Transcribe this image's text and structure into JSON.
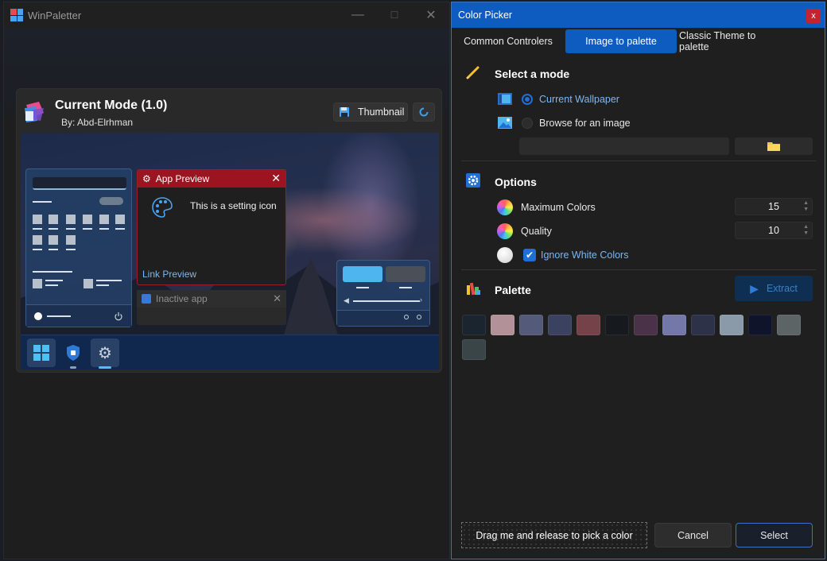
{
  "main_window": {
    "title": "WinPaletter",
    "controls": {
      "minimize": "—",
      "maximize": "☐",
      "close": "✕"
    },
    "theme_card": {
      "title": "Current Mode (1.0)",
      "author": "By: Abd-Elrhman",
      "thumbnail_label": "Thumbnail"
    },
    "preview": {
      "app_preview_title": "App Preview",
      "app_preview_text": "This is a setting icon",
      "link_preview": "Link Preview",
      "inactive_app_title": "Inactive app"
    }
  },
  "color_picker": {
    "title": "Color Picker",
    "close_label": "x",
    "tabs": [
      {
        "label": "Common Controlers",
        "active": false
      },
      {
        "label": "Image to palette",
        "active": true
      },
      {
        "label": "Classic Theme to palette",
        "active": false
      }
    ],
    "mode_section": {
      "title": "Select a mode",
      "options": [
        {
          "label": "Current Wallpaper",
          "selected": true
        },
        {
          "label": "Browse for an image",
          "selected": false
        }
      ],
      "path_value": ""
    },
    "options_section": {
      "title": "Options",
      "max_colors_label": "Maximum Colors",
      "max_colors_value": "15",
      "quality_label": "Quality",
      "quality_value": "10",
      "ignore_white_label": "Ignore White Colors",
      "ignore_white_checked": true
    },
    "palette_section": {
      "title": "Palette",
      "extract_label": "Extract",
      "swatches": [
        "#1b2530",
        "#b29298",
        "#535a7a",
        "#3a4260",
        "#744248",
        "#161a1e",
        "#4a3348",
        "#7378a8",
        "#2e3248",
        "#8b9aa8",
        "#10142a",
        "#5c6466",
        "#3a4548"
      ]
    },
    "footer": {
      "drag_label": "Drag me and release to pick a color",
      "cancel_label": "Cancel",
      "select_label": "Select"
    }
  }
}
